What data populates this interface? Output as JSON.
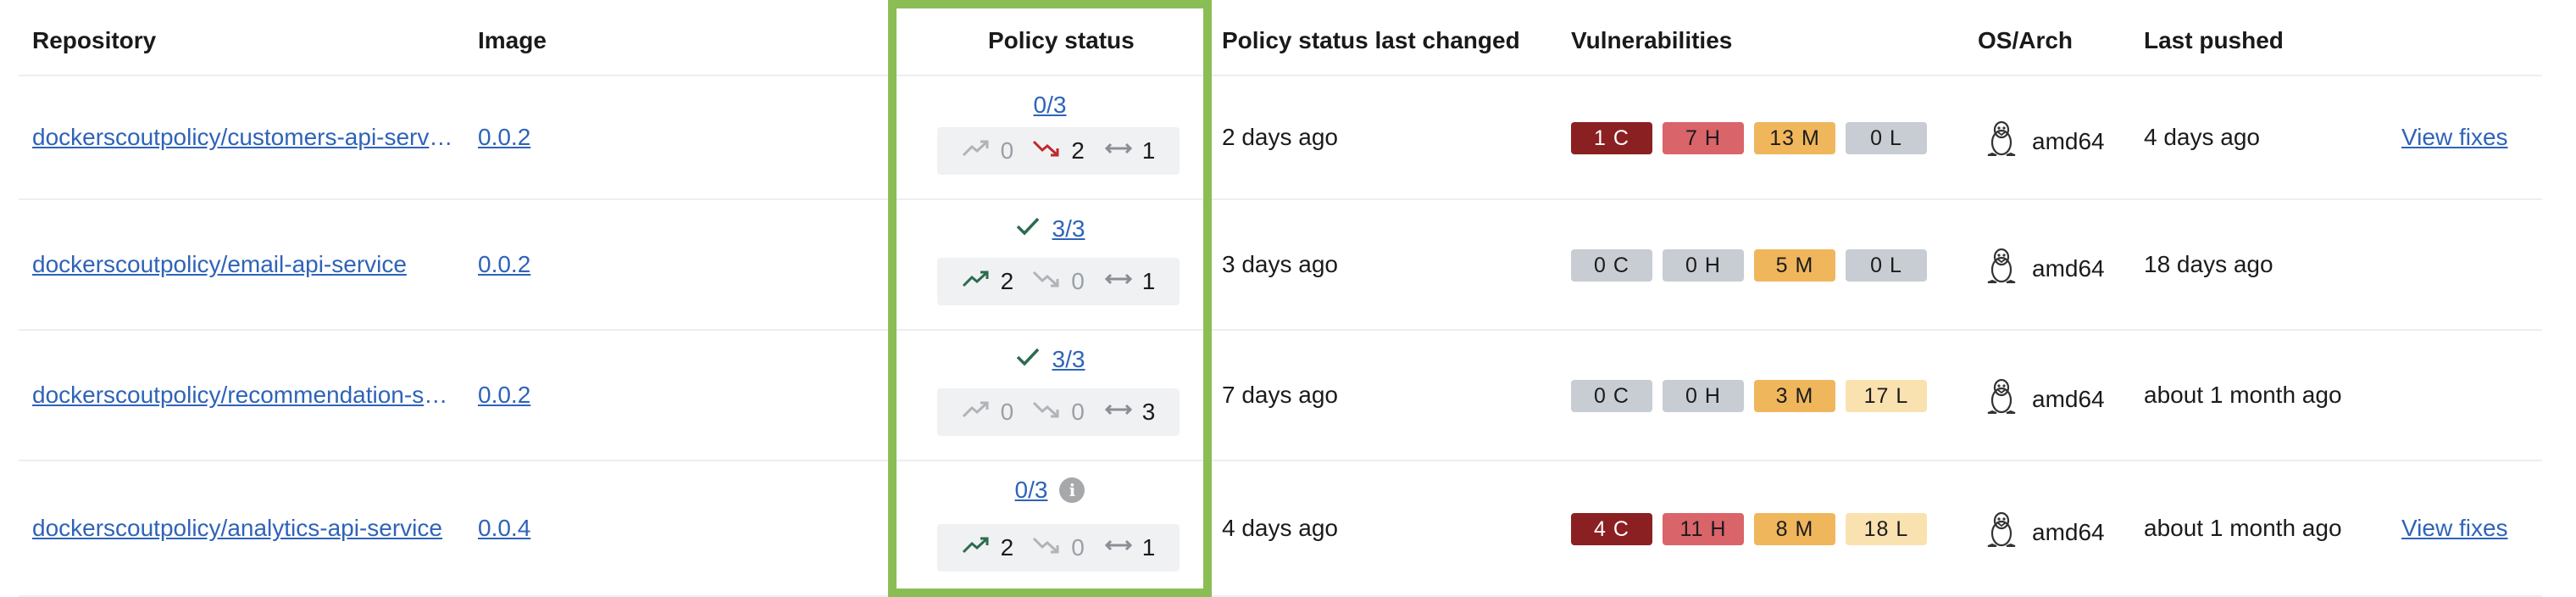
{
  "headers": {
    "repository": "Repository",
    "image": "Image",
    "policy_status": "Policy status",
    "policy_changed": "Policy status last changed",
    "vulnerabilities": "Vulnerabilities",
    "os_arch": "OS/Arch",
    "last_pushed": "Last pushed"
  },
  "colors": {
    "frame": "#8bbd55",
    "critical": "#8b2022",
    "high": "#d9646a",
    "medium": "#f0b65c",
    "low_zero": "#c8ccd3",
    "low_nonzero": "#fae2b0",
    "link": "#2f63b8",
    "trend_up": "#2d6b4e",
    "trend_down": "#c0282f"
  },
  "rows": [
    {
      "repository": "dockerscoutpolicy/customers-api-service",
      "image": "0.0.2",
      "policy_ratio": "0/3",
      "policy_ok": false,
      "policy_info": false,
      "improved": "0",
      "worsened": "2",
      "unchanged": "1",
      "changed": "2 days ago",
      "vulns": {
        "c": "1 C",
        "h": "7 H",
        "m": "13 M",
        "l": "0 L"
      },
      "os": "amd64",
      "pushed": "4 days ago",
      "fixes": "View fixes"
    },
    {
      "repository": "dockerscoutpolicy/email-api-service",
      "image": "0.0.2",
      "policy_ratio": "3/3",
      "policy_ok": true,
      "policy_info": false,
      "improved": "2",
      "worsened": "0",
      "unchanged": "1",
      "changed": "3 days ago",
      "vulns": {
        "c": "0 C",
        "h": "0 H",
        "m": "5 M",
        "l": "0 L"
      },
      "os": "amd64",
      "pushed": "18 days ago",
      "fixes": ""
    },
    {
      "repository": "dockerscoutpolicy/recommendation-service",
      "image": "0.0.2",
      "policy_ratio": "3/3",
      "policy_ok": true,
      "policy_info": false,
      "improved": "0",
      "worsened": "0",
      "unchanged": "3",
      "changed": "7 days ago",
      "vulns": {
        "c": "0 C",
        "h": "0 H",
        "m": "3 M",
        "l": "17 L"
      },
      "os": "amd64",
      "pushed": "about 1 month ago",
      "fixes": ""
    },
    {
      "repository": "dockerscoutpolicy/analytics-api-service",
      "image": "0.0.4",
      "policy_ratio": "0/3",
      "policy_ok": false,
      "policy_info": true,
      "improved": "2",
      "worsened": "0",
      "unchanged": "1",
      "changed": "4 days ago",
      "vulns": {
        "c": "4 C",
        "h": "11 H",
        "m": "8 M",
        "l": "18 L"
      },
      "os": "amd64",
      "pushed": "about 1 month ago",
      "fixes": "View fixes"
    }
  ]
}
